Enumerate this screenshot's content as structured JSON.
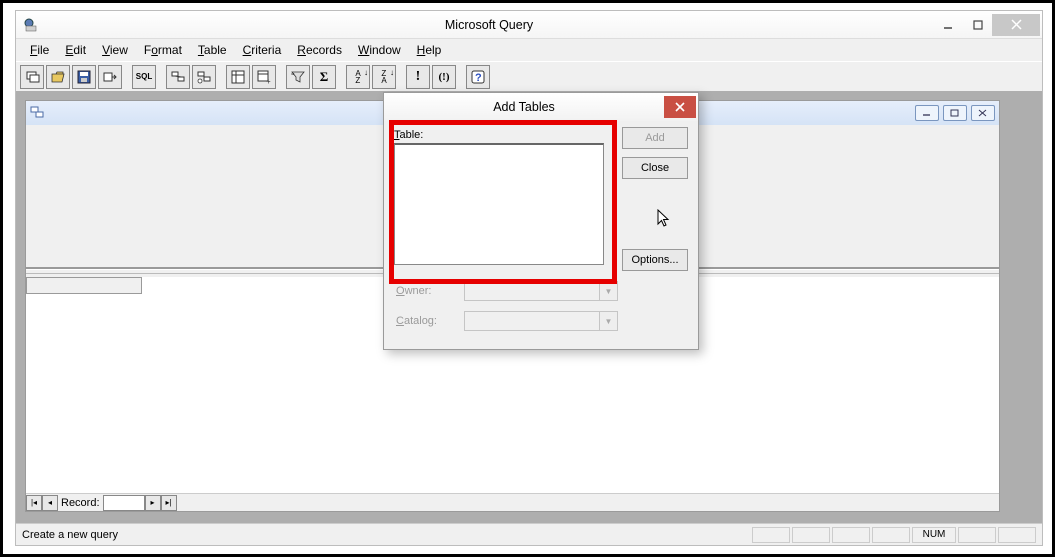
{
  "app": {
    "title": "Microsoft Query"
  },
  "menus": {
    "file": "File",
    "edit": "Edit",
    "view": "View",
    "format": "Format",
    "table": "Table",
    "criteria": "Criteria",
    "records": "Records",
    "window": "Window",
    "help": "Help"
  },
  "toolbar_icons": {
    "new": "new-query-icon",
    "open": "open-icon",
    "save": "save-icon",
    "return": "return-data-icon",
    "sql": "SQL",
    "show_tables": "show-tables-icon",
    "add_table": "add-table-icon",
    "criteria": "criteria-icon",
    "add_criteria": "add-criteria-icon",
    "filter": "filter-icon",
    "totals": "sigma-icon",
    "sort_asc": "sort-asc-icon",
    "sort_desc": "sort-desc-icon",
    "run": "run-icon",
    "auto_query": "auto-query-icon",
    "help": "help-icon"
  },
  "record_nav": {
    "label": "Record:",
    "value": ""
  },
  "status": {
    "message": "Create a new query",
    "num": "NUM"
  },
  "dialog": {
    "title": "Add Tables",
    "table_label": "Table:",
    "add": "Add",
    "close": "Close",
    "options": "Options...",
    "owner": "Owner:",
    "catalog": "Catalog:"
  }
}
